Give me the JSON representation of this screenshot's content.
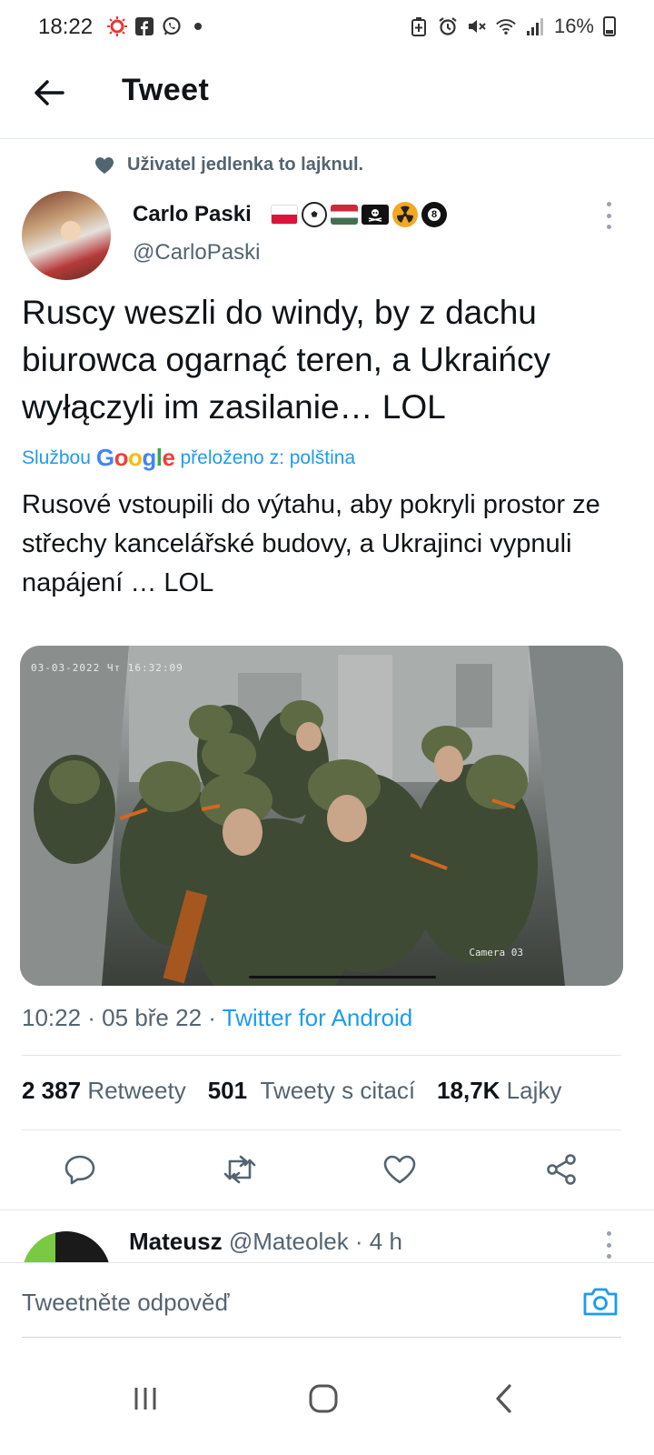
{
  "status_bar": {
    "time": "18:22",
    "battery": "16%",
    "icons": [
      "notification-icon",
      "facebook-icon",
      "whatsapp-icon",
      "dot-icon",
      "battery-saver-icon",
      "alarm-icon",
      "mute-icon",
      "wifi-icon",
      "signal-icon",
      "battery-icon"
    ]
  },
  "header": {
    "title": "Tweet"
  },
  "liked_by": {
    "text": "Uživatel jedlenka to lajknul."
  },
  "author": {
    "name": "Carlo Paski",
    "handle": "@CarloPaski",
    "badges": [
      "poland-flag",
      "soccer-ball",
      "hungary-flag",
      "pirate-flag",
      "radioactive-icon",
      "eight-ball"
    ]
  },
  "tweet": {
    "text": "Ruscy weszli do windy, by z dachu biurowca ogarnąć teren, a Ukraińcy wyłączyli im zasilanie… LOL",
    "translated_prefix": "Službou",
    "translated_brand": "Google",
    "translated_suffix": "přeloženo z: polština",
    "translation": "Rusové vstoupili do výtahu, aby pokryli prostor ze střechy kancelářské budovy, a Ukrajinci vypnuli napájení … LOL",
    "media": {
      "camera_timestamp": "03-03-2022 Чт 16:32:09",
      "camera_label": "Camera 03"
    },
    "time": "10:22 · 05 bře 22 · ",
    "source": "Twitter for Android"
  },
  "stats": {
    "retweets_count": "2 387",
    "retweets_label": "Retweety",
    "quotes_count": "501",
    "quotes_label": "Tweety s citací",
    "likes_count": "18,7K",
    "likes_label": "Lajky"
  },
  "actions": [
    "reply-icon",
    "retweet-icon",
    "like-icon",
    "share-icon"
  ],
  "reply_preview": {
    "name": "Mateusz",
    "handle_time": "@Mateolek · 4 h"
  },
  "composer": {
    "placeholder": "Tweetněte odpověď"
  },
  "colors": {
    "accent": "#1d9bf0",
    "text": "#0f1419",
    "secondary": "#536471"
  }
}
